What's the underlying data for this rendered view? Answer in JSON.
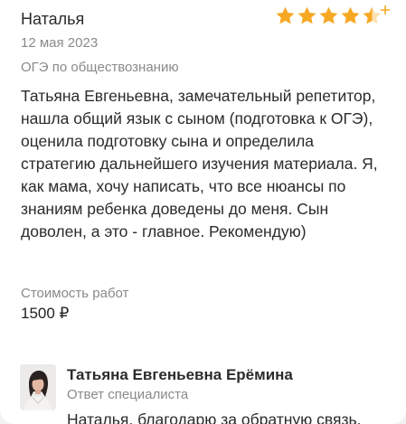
{
  "review": {
    "author": "Наталья",
    "rating": 4.5,
    "star_color": "#f7a823",
    "date": "12 мая 2023",
    "subject": "ОГЭ по обществознанию",
    "text": "Татьяна Евгеньевна, замечательный репетитор, нашла общий язык с сыном (подготовка к ОГЭ), оценила подготовку сына и определила стратегию дальнейшего изучения материала. Я, как мама, хочу написать, что все нюансы по знаниям ребенка доведены до меня. Сын доволен, а это - главное. Рекомендую)",
    "cost_label": "Стоимость работ",
    "cost_value": "1500 ₽"
  },
  "response": {
    "name": "Татьяна Евгеньевна Ерёмина",
    "role": "Ответ специалиста",
    "text": "Наталья, благодарю за обратную связь."
  }
}
